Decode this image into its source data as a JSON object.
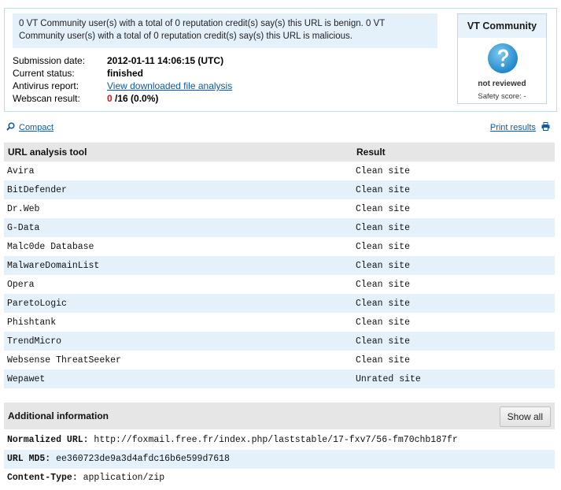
{
  "summary": {
    "notice": "0 VT Community user(s) with a total of 0 reputation credit(s) say(s) this URL is benign. 0 VT Community user(s) with a total of 0 reputation credit(s) say(s) this URL is malicious.",
    "submission_date_label": "Submission date:",
    "submission_date_value": "2012-01-11 14:06:15 (UTC)",
    "current_status_label": "Current status:",
    "current_status_value": "finished",
    "antivirus_report_label": "Antivirus report:",
    "antivirus_report_link": "View downloaded file analysis",
    "webscan_label": "Webscan result:",
    "webscan_detections": "0",
    "webscan_rest": " /16 (0.0%)"
  },
  "community": {
    "title": "VT Community",
    "status": "not reviewed",
    "safety_score": "Safety score: -"
  },
  "links": {
    "compact": "Compact",
    "print": "Print results"
  },
  "table": {
    "headers": [
      "URL analysis tool",
      "Result"
    ],
    "rows": [
      {
        "tool": "Avira",
        "result": "Clean site"
      },
      {
        "tool": "BitDefender",
        "result": "Clean site"
      },
      {
        "tool": "Dr.Web",
        "result": "Clean site"
      },
      {
        "tool": "G-Data",
        "result": "Clean site"
      },
      {
        "tool": "Malc0de Database",
        "result": "Clean site"
      },
      {
        "tool": "MalwareDomainList",
        "result": "Clean site"
      },
      {
        "tool": "Opera",
        "result": "Clean site"
      },
      {
        "tool": "ParetoLogic",
        "result": "Clean site"
      },
      {
        "tool": "Phishtank",
        "result": "Clean site"
      },
      {
        "tool": "TrendMicro",
        "result": "Clean site"
      },
      {
        "tool": "Websense ThreatSeeker",
        "result": "Clean site"
      },
      {
        "tool": "Wepawet",
        "result": "Unrated site"
      }
    ]
  },
  "additional": {
    "title": "Additional information",
    "show_all": "Show all",
    "normalized_url_label": "Normalized URL:",
    "normalized_url_value": " http://foxmail.free.fr/index.php/laststable/17-fxv7/56-fm70chb187fr",
    "md5_label": "URL MD5:",
    "md5_value": " ee360723de9a3d4afdc16b6e599d7618",
    "content_type_label": "Content-Type:",
    "content_type_value": " application/zip"
  },
  "colors": {
    "accent_blue": "#0c5aa6",
    "row_alt": "#e4f1fb",
    "header_gray": "#e6e6e6",
    "detections_red": "#e01010",
    "community_icon": "#2d9ad8"
  },
  "icons": [
    "question-icon",
    "magnifier-icon",
    "printer-icon"
  ]
}
